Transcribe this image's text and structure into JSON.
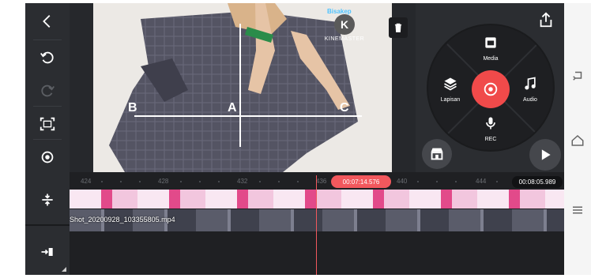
{
  "toolbar": {
    "back_icon": "back-arrow-icon",
    "undo_icon": "undo-icon",
    "redo_icon": "redo-icon",
    "fullscreen_icon": "fullscreen-icon",
    "settings_icon": "settings-icon"
  },
  "preview": {
    "labels": {
      "a": "A",
      "b": "B",
      "c": "C"
    },
    "watermark": {
      "small": "Bisakep",
      "logo": "K",
      "text": "KINEMASTER"
    }
  },
  "media_wheel": {
    "media_label": "Media",
    "layer_label": "Lapisan",
    "audio_label": "Audio",
    "rec_label": "REC"
  },
  "timeline": {
    "ticks": [
      "424",
      "428",
      "432",
      "436",
      "440",
      "444"
    ],
    "current_time": "00:07:14.576",
    "total_time": "00:08:05.989",
    "clip_name": "Shot_20200928_103355805.mp4"
  },
  "colors": {
    "accent": "#f04a4a",
    "panel": "#2b2d31",
    "timeline_bg": "#1f2023",
    "layer_track": "#f6e6f1"
  }
}
